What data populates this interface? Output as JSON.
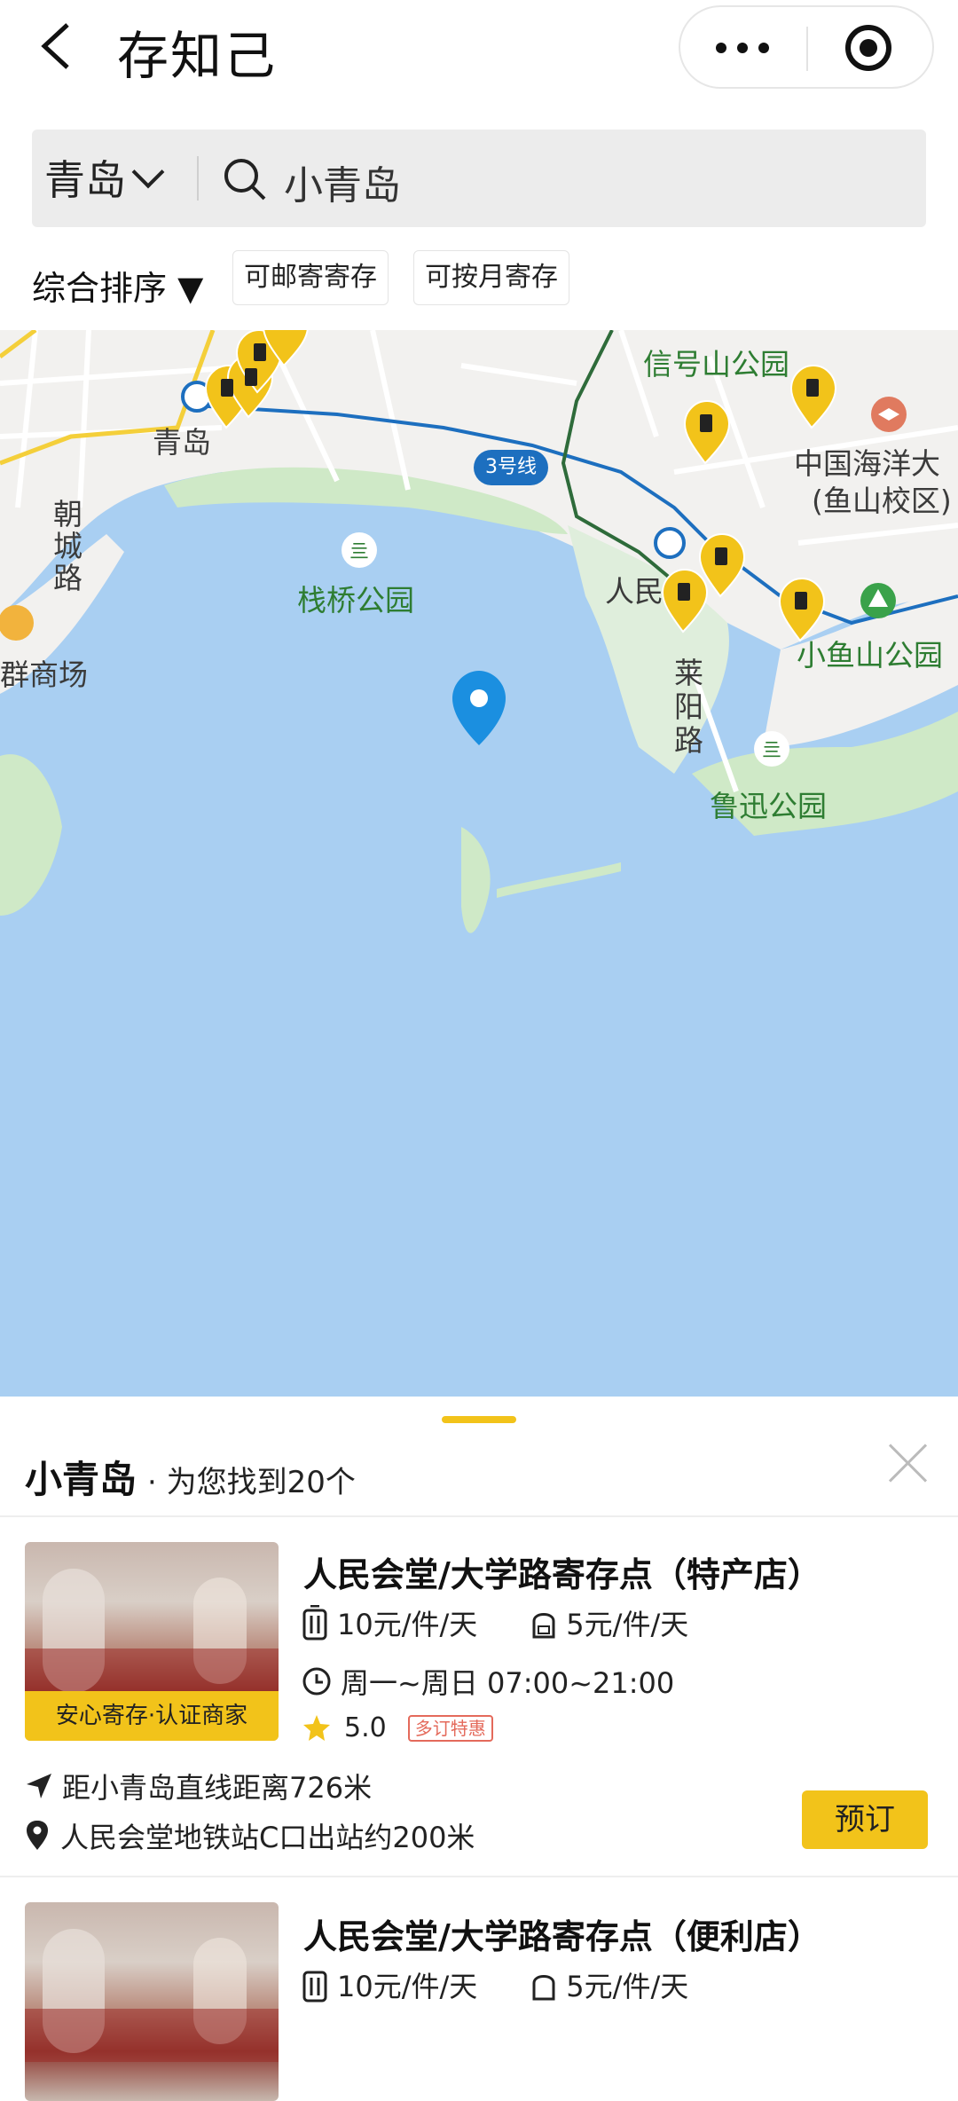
{
  "nav": {
    "title": "存知己"
  },
  "search": {
    "city": "青岛",
    "query": "小青岛"
  },
  "filters": {
    "sort": "综合排序 ▼",
    "chips": [
      "可邮寄寄存",
      "可按月寄存"
    ]
  },
  "map": {
    "labels": {
      "qingdao_station": "青岛",
      "chaocheng_road": "朝城路",
      "market": "群商场",
      "zhanqiao_park": "栈桥公园",
      "xinhaoshan_park": "信号山公园",
      "ocean_univ_1": "中国海洋大",
      "ocean_univ_2": "(鱼山校区)",
      "renmin": "人民",
      "xiaoyushan_park": "小鱼山公园",
      "laiyang_road": "莱阳路",
      "luxun_park": "鲁迅公园",
      "line3": "3号线"
    }
  },
  "sheet": {
    "location": "小青岛",
    "count_text": "· 为您找到20个",
    "stores": [
      {
        "title": "人民会堂/大学路寄存点（特产店）",
        "badge": "安心寄存·认证商家",
        "price_luggage": "10元/件/天",
        "price_bag": "5元/件/天",
        "hours": "周一~周日 07:00~21:00",
        "rating": "5.0",
        "promo": "多订特惠",
        "distance": "距小青岛直线距离726米",
        "directions": "人民会堂地铁站C口出站约200米",
        "book": "预订"
      },
      {
        "title": "人民会堂/大学路寄存点（便利店）",
        "price_luggage": "10元/件/天",
        "price_bag": "5元/件/天"
      }
    ]
  }
}
